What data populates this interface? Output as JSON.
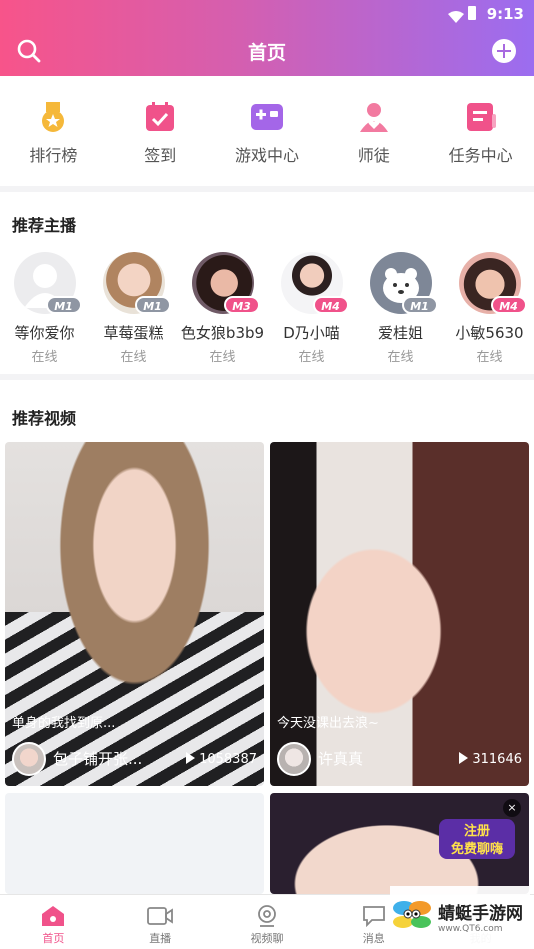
{
  "status_bar": {
    "time": "9:13"
  },
  "header": {
    "title": "首页"
  },
  "quick_menu": [
    {
      "label": "排行榜",
      "icon": "medal-icon",
      "color": "#f5b83a"
    },
    {
      "label": "签到",
      "icon": "calendar-check-icon",
      "color": "#f0528a"
    },
    {
      "label": "游戏中心",
      "icon": "gamepad-icon",
      "color": "#a466e8"
    },
    {
      "label": "师徒",
      "icon": "mentor-icon",
      "color": "#f27aa0"
    },
    {
      "label": "任务中心",
      "icon": "task-icon",
      "color": "#f0528a"
    }
  ],
  "streamers_section": {
    "title": "推荐主播"
  },
  "streamers": [
    {
      "name": "等你爱你",
      "status": "在线",
      "level": "M1",
      "badge_color": "#8f96a3"
    },
    {
      "name": "草莓蛋糕",
      "status": "在线",
      "level": "M1",
      "badge_color": "#8f96a3"
    },
    {
      "name": "色女狼b3b9",
      "status": "在线",
      "level": "M3",
      "badge_color": "#f0528a"
    },
    {
      "name": "D乃小喵",
      "status": "在线",
      "level": "M4",
      "badge_color": "#f0528a"
    },
    {
      "name": "爱桂姐",
      "status": "在线",
      "level": "M1",
      "badge_color": "#8f96a3"
    },
    {
      "name": "小敏5630",
      "status": "在线",
      "level": "M4",
      "badge_color": "#f0528a"
    }
  ],
  "videos_section": {
    "title": "推荐视频"
  },
  "videos": [
    {
      "caption": "单身的我找到原...",
      "owner": "包子铺开张...",
      "views": "1058387"
    },
    {
      "caption": "今天没课出去浪~",
      "owner": "许真真",
      "views": "311646"
    }
  ],
  "promo": {
    "line1": "注册",
    "line2": "免费聊嗨",
    "close": "×"
  },
  "tabbar": [
    {
      "label": "首页",
      "icon": "home-icon"
    },
    {
      "label": "直播",
      "icon": "video-camera-icon"
    },
    {
      "label": "视频聊",
      "icon": "webcam-icon"
    },
    {
      "label": "消息",
      "icon": "chat-icon"
    },
    {
      "label": "我的",
      "icon": "profile-icon"
    }
  ],
  "watermark": {
    "title": "蜻蜓手游网",
    "url": "www.QT6.com"
  },
  "colors": {
    "accent": "#f0528a",
    "header_start": "#f7548a",
    "header_end": "#9b6df0"
  }
}
